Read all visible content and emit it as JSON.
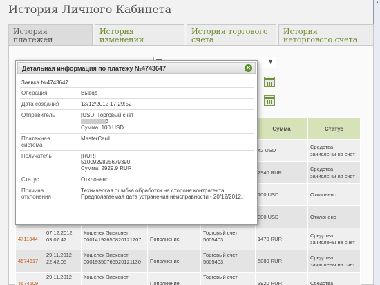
{
  "page": {
    "title": "История Личного Кабинета"
  },
  "tabs": [
    {
      "label": "История платежей"
    },
    {
      "label": "История изменений"
    },
    {
      "label": "История торгового счета"
    },
    {
      "label": "История неторгового счета"
    }
  ],
  "colors": {
    "accent": "#6a8b2a",
    "header_green": "#d6e3b8",
    "id_link": "#c25a1a"
  },
  "table": {
    "headers": {
      "sum": "Сумма",
      "status": "Статус"
    },
    "rows": [
      {
        "id": "",
        "date": "",
        "time": "",
        "wallet": "",
        "wallet_no": "",
        "op": "",
        "acct": "",
        "acct_no": "",
        "sum": "42 USD",
        "status": "Средства зачислены на счет"
      },
      {
        "id": "",
        "date": "",
        "time": "",
        "wallet": "",
        "wallet_no": "",
        "op": "",
        "acct": "",
        "acct_no": "",
        "sum": "2940 RUR",
        "status": "Средства зачислены на счет"
      },
      {
        "id": "",
        "date": "",
        "time": "",
        "wallet": "",
        "wallet_no": "",
        "op": "",
        "acct": "",
        "acct_no": "",
        "sum": "100 USD",
        "status": "Отклонено"
      },
      {
        "id": "",
        "date": "",
        "time": "",
        "wallet": "",
        "wallet_no": "",
        "op": "",
        "acct": "",
        "acct_no": "",
        "sum": "300 USD",
        "status": "Отклонено"
      },
      {
        "id": "4711344",
        "date": "07.12.2012",
        "time": "03:07:42",
        "wallet": "Кошелек Элекснет",
        "wallet_no": "00014192650820121207",
        "op": "Пополнение",
        "acct": "Торговый счет",
        "acct_no": "5005403",
        "sum": "1470 RUR",
        "status": "Средства зачислены на счет"
      },
      {
        "id": "4674617",
        "date": "29.11.2012",
        "time": "22:42:05",
        "wallet": "Кошелек Элекснет",
        "wallet_no": "00019350766520121130",
        "op": "Пополнение",
        "acct": "Торговый счет",
        "acct_no": "5005403",
        "sum": "5880 RUR",
        "status": "Средства зачислены на счет"
      },
      {
        "id": "4674609",
        "date": "29.11.2012",
        "time": "",
        "wallet": "Кошелек Элекснет",
        "wallet_no": "",
        "op": "Пополнение",
        "acct": "Торговый счет",
        "acct_no": "",
        "sum": "3920 RUR",
        "status": "Средства"
      }
    ]
  },
  "modal": {
    "title": "Детальная информация по платежу №4743647",
    "close_icon": "close-icon",
    "order": "Заявка №4743647",
    "fields": {
      "operation": {
        "label": "Операция",
        "value": "Вывод"
      },
      "created": {
        "label": "Дата создания",
        "value": "13/12/2012 17:29:52"
      },
      "sender": {
        "label": "Отправитель",
        "line1": "[USD] Торговый счет",
        "line2_tail": "3",
        "line3": "Сумма: 100 USD"
      },
      "system": {
        "label1": "Платежная",
        "label2": "система",
        "value": "MasterCard"
      },
      "recipient": {
        "label": "Получатель",
        "line1": "[RUR]",
        "line2": "5100929825679390",
        "line3": "Сумма: 2929.9 RUR"
      },
      "status": {
        "label": "Статус",
        "value": "Отклонено"
      },
      "reason": {
        "label1": "Причина",
        "label2": "отклонения",
        "value": "Техническая ошибка обработки на стороне контрагента. Предполагаемая дата устранения неисправности - 20/12/2012."
      }
    }
  }
}
